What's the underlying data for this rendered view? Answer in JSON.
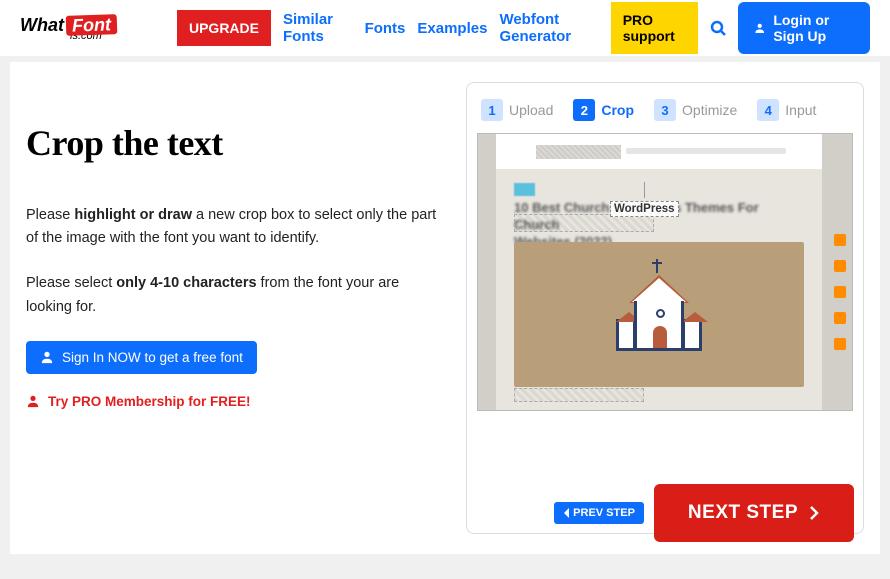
{
  "header": {
    "logo": {
      "what": "What",
      "font": "Font",
      "is": "is.com"
    },
    "upgrade": "UPGRADE",
    "nav": {
      "similar": "Similar Fonts",
      "fonts": "Fonts",
      "examples": "Examples",
      "webfont": "Webfont Generator"
    },
    "pro_support": "PRO support",
    "login": "Login or Sign Up"
  },
  "left": {
    "title": "Crop the text",
    "instr1_pre": "Please ",
    "instr1_bold": "highlight or draw",
    "instr1_post": " a new crop box to select only the part of the image with the font you want to identify.",
    "instr2_pre": "Please select ",
    "instr2_bold": "only 4-10 characters",
    "instr2_post": " from the font your are looking for.",
    "signin": "Sign In NOW to get a free font",
    "trypro": "Try PRO Membership for FREE!"
  },
  "steps": [
    {
      "num": "1",
      "label": "Upload",
      "active": false
    },
    {
      "num": "2",
      "label": "Crop",
      "active": true
    },
    {
      "num": "3",
      "label": "Optimize",
      "active": false
    },
    {
      "num": "4",
      "label": "Input",
      "active": false
    }
  ],
  "preview": {
    "crop_text": "WordPress",
    "blur_title_a": "10 Best Church WordPress Themes For Church",
    "blur_title_b": "Websites (2022)"
  },
  "footer": {
    "prev": "PREV STEP",
    "next": "NEXT STEP"
  }
}
